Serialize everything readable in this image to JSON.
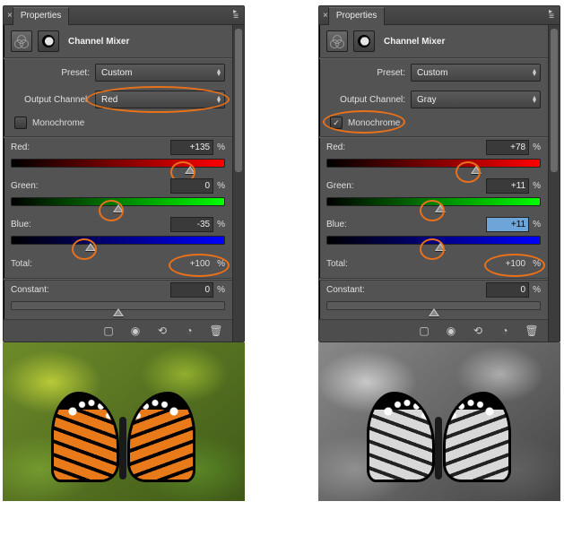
{
  "panel_title": "Properties",
  "adjustment_title": "Channel Mixer",
  "labels": {
    "preset": "Preset:",
    "output_channel": "Output Channel:",
    "monochrome": "Monochrome",
    "red": "Red:",
    "green": "Green:",
    "blue": "Blue:",
    "total": "Total:",
    "constant": "Constant:",
    "percent": "%"
  },
  "left": {
    "preset": "Custom",
    "output_channel": "Red",
    "monochrome": false,
    "red": "+135",
    "green": "0",
    "blue": "-35",
    "total": "+100",
    "constant": "0",
    "slider_pos": {
      "red": 84,
      "green": 50,
      "blue": 37,
      "constant": 50
    }
  },
  "right": {
    "preset": "Custom",
    "output_channel": "Gray",
    "monochrome": true,
    "red": "+78",
    "green": "+11",
    "blue": "+11",
    "total": "+100",
    "constant": "0",
    "slider_pos": {
      "red": 70,
      "green": 53,
      "blue": 53,
      "constant": 50
    }
  },
  "icons": {
    "clip": "clip-to-layer-icon",
    "prev": "view-previous-icon",
    "reset": "reset-icon",
    "visibility": "visibility-icon",
    "trash": "trash-icon"
  }
}
